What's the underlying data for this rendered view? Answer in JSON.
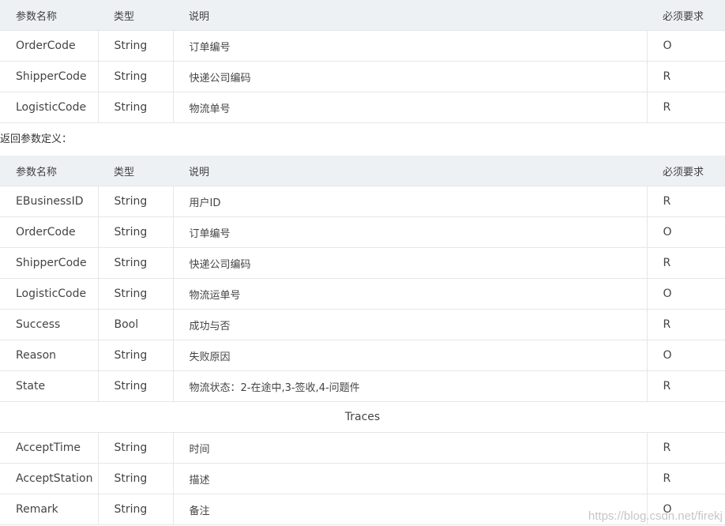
{
  "header": {
    "name": "参数名称",
    "type": "类型",
    "desc": "说明",
    "required": "必须要求"
  },
  "request_table": {
    "rows": [
      {
        "name": "OrderCode",
        "type": "String",
        "desc": "订单编号",
        "required": "O"
      },
      {
        "name": "ShipperCode",
        "type": "String",
        "desc": "快递公司编码",
        "required": "R"
      },
      {
        "name": "LogisticCode",
        "type": "String",
        "desc": "物流单号",
        "required": "R"
      }
    ]
  },
  "return_title": "返回参数定义：",
  "response_table": {
    "rows": [
      {
        "name": "EBusinessID",
        "type": "String",
        "desc": "用户ID",
        "required": "R"
      },
      {
        "name": "OrderCode",
        "type": "String",
        "desc": "订单编号",
        "required": "O"
      },
      {
        "name": "ShipperCode",
        "type": "String",
        "desc": "快递公司编码",
        "required": "R"
      },
      {
        "name": "LogisticCode",
        "type": "String",
        "desc": "物流运单号",
        "required": "O"
      },
      {
        "name": "Success",
        "type": "Bool",
        "desc": "成功与否",
        "required": "R"
      },
      {
        "name": "Reason",
        "type": "String",
        "desc": "失败原因",
        "required": "O"
      },
      {
        "name": "State",
        "type": "String",
        "desc": "物流状态：2-在途中,3-签收,4-问题件",
        "required": "R"
      }
    ],
    "section_label": "Traces",
    "trace_rows": [
      {
        "name": "AcceptTime",
        "type": "String",
        "desc": "时间",
        "required": "R"
      },
      {
        "name": "AcceptStation",
        "type": "String",
        "desc": "描述",
        "required": "R"
      },
      {
        "name": "Remark",
        "type": "String",
        "desc": "备注",
        "required": "O"
      }
    ]
  },
  "watermark": "https://blog.csdn.net/firekj"
}
